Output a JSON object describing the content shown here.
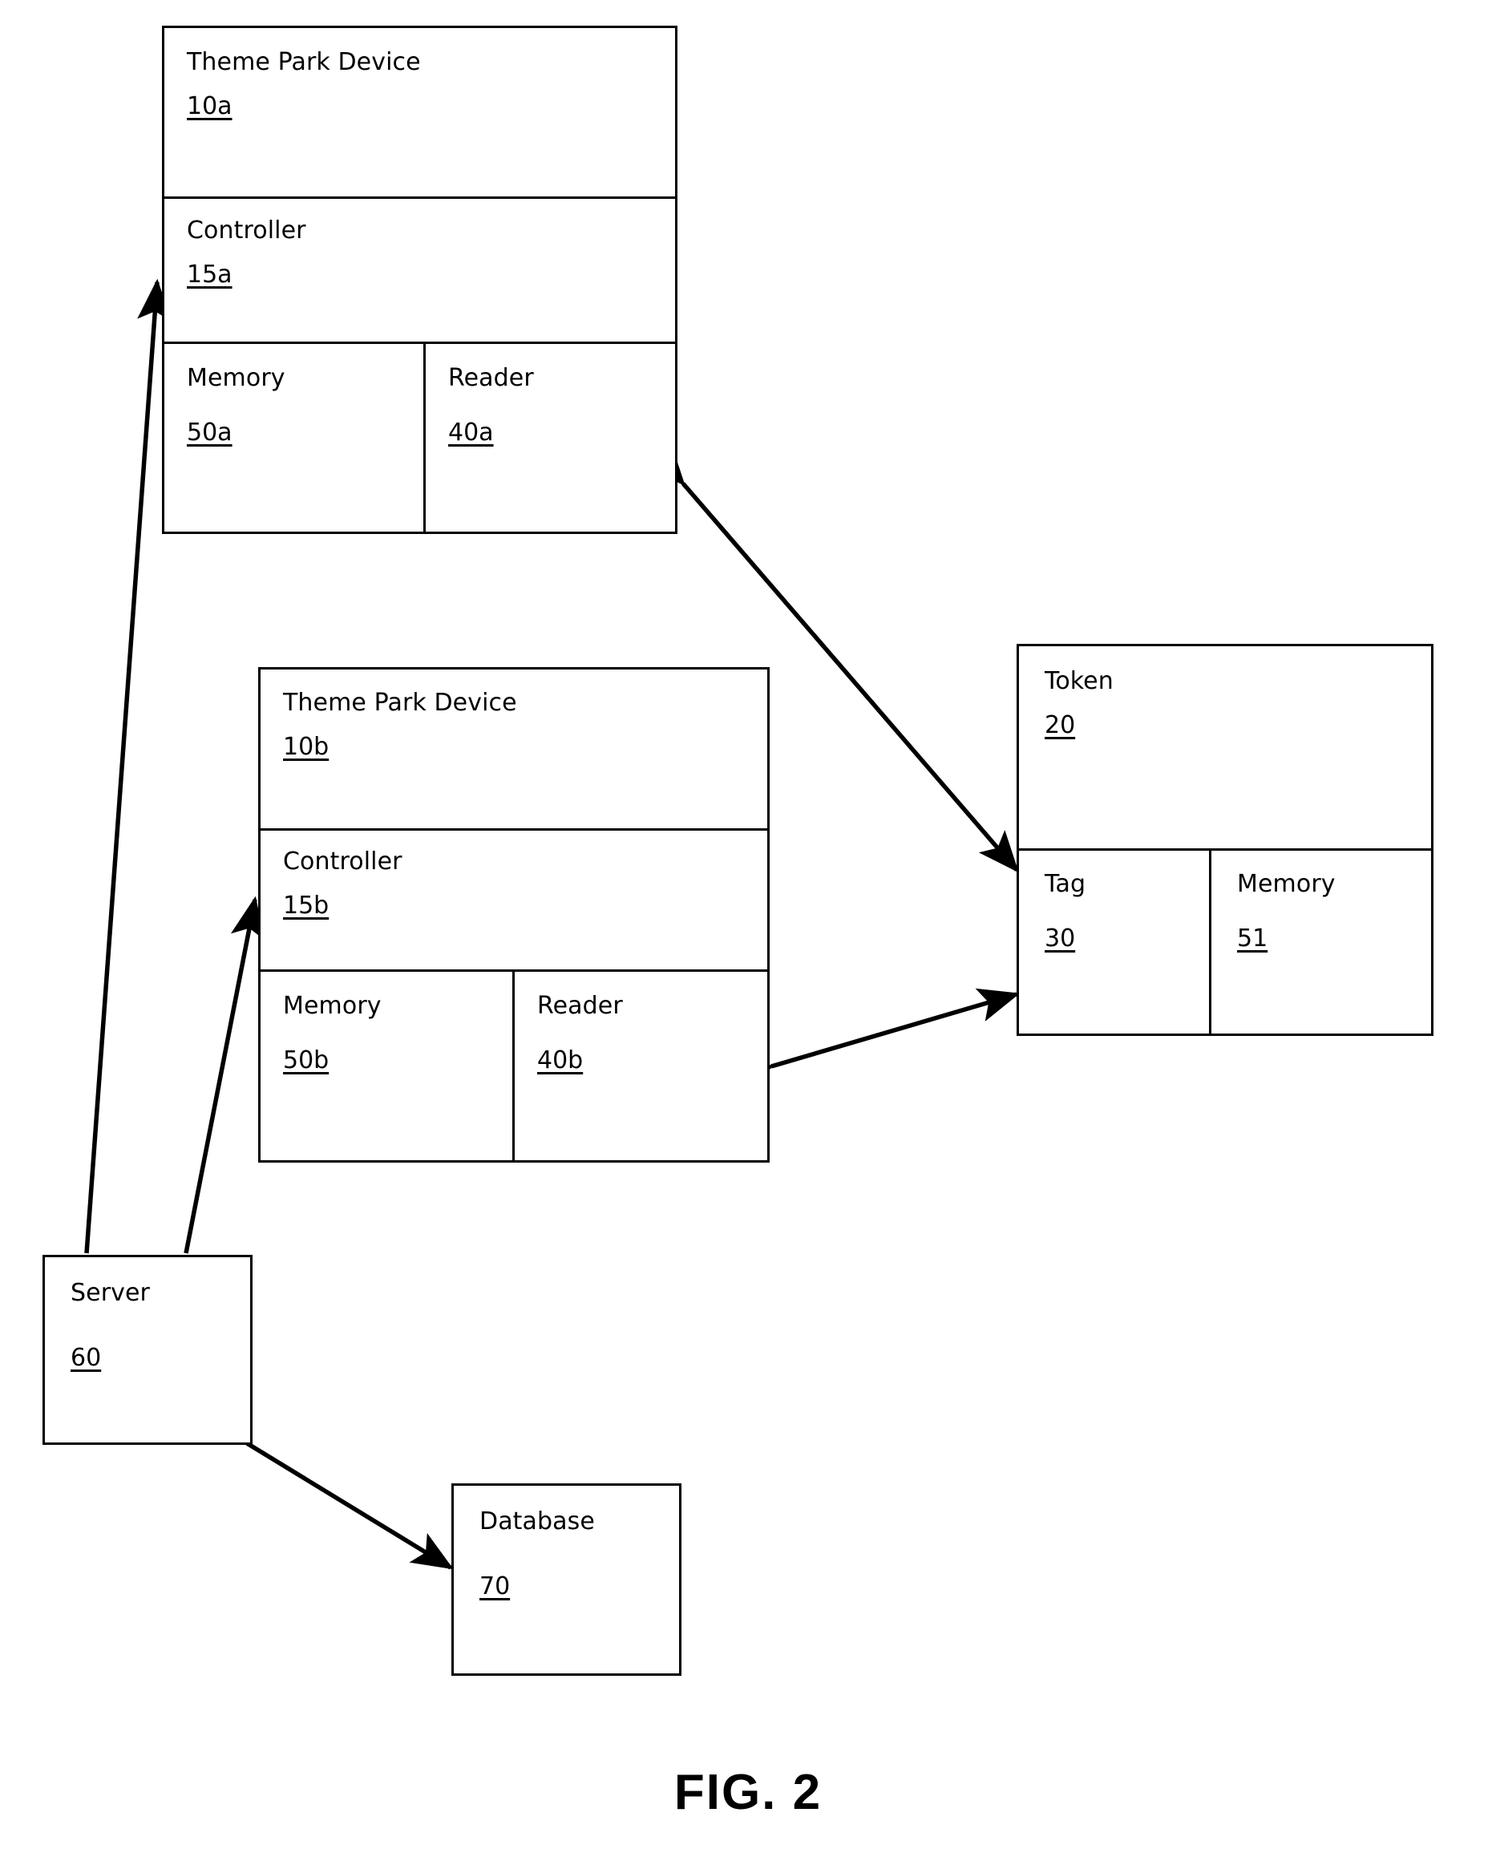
{
  "figure": {
    "caption": "FIG. 2"
  },
  "nodes": {
    "device_a": {
      "title": "Theme Park Device",
      "ref": "10a",
      "controller": {
        "title": "Controller",
        "ref": "15a"
      },
      "memory": {
        "title": "Memory",
        "ref": "50a"
      },
      "reader": {
        "title": "Reader",
        "ref": "40a"
      }
    },
    "device_b": {
      "title": "Theme Park Device",
      "ref": "10b",
      "controller": {
        "title": "Controller",
        "ref": "15b"
      },
      "memory": {
        "title": "Memory",
        "ref": "50b"
      },
      "reader": {
        "title": "Reader",
        "ref": "40b"
      }
    },
    "token": {
      "title": "Token",
      "ref": "20",
      "tag": {
        "title": "Tag",
        "ref": "30"
      },
      "memory": {
        "title": "Memory",
        "ref": "51"
      }
    },
    "server": {
      "title": "Server",
      "ref": "60"
    },
    "database": {
      "title": "Database",
      "ref": "70"
    }
  },
  "connections": [
    {
      "name": "device-a-to-token",
      "from": "device_a",
      "to": "token",
      "style": "double-arrow"
    },
    {
      "name": "device-b-to-token",
      "from": "device_b",
      "to": "token",
      "style": "double-arrow"
    },
    {
      "name": "server-to-device-a-controller",
      "from": "server",
      "to": "device_a.controller",
      "style": "single-arrow"
    },
    {
      "name": "server-to-device-b-controller",
      "from": "server",
      "to": "device_b.controller",
      "style": "single-arrow"
    },
    {
      "name": "server-to-database",
      "from": "server",
      "to": "database",
      "style": "double-arrow"
    }
  ],
  "colors": {
    "stroke": "#000000",
    "background": "#ffffff"
  }
}
